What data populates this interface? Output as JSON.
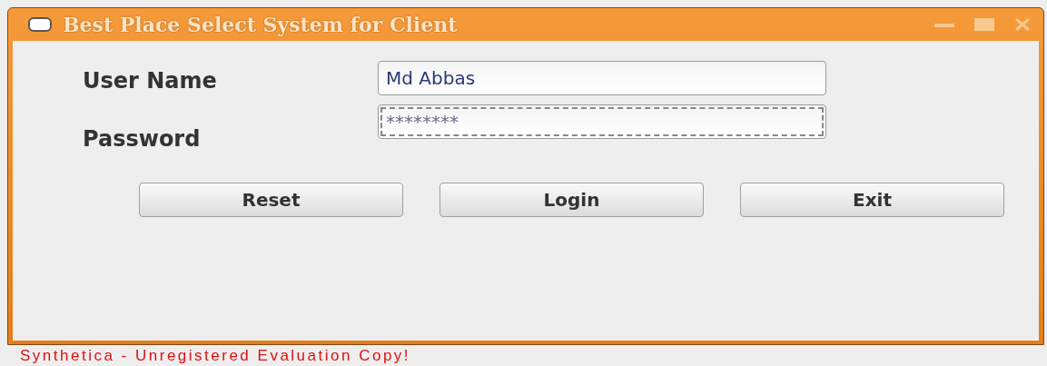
{
  "window": {
    "title": "Best Place Select System for Client"
  },
  "form": {
    "fields": [
      {
        "label": "User Name",
        "value": "Md Abbas",
        "focused": false
      },
      {
        "label": "Password",
        "value": "********",
        "focused": true
      }
    ]
  },
  "buttons": [
    "Reset",
    "Login",
    "Exit"
  ],
  "status_text": "Synthetica - Unregistered Evaluation Copy!"
}
